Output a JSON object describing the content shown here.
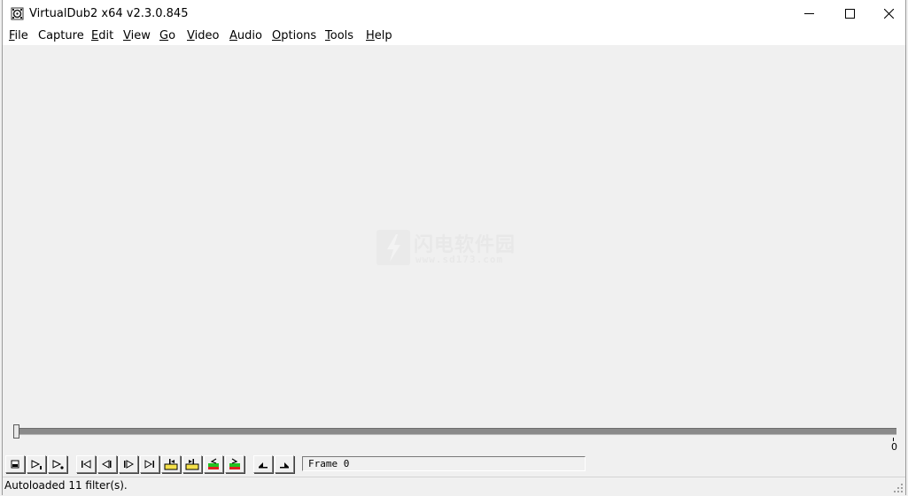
{
  "window": {
    "title": "VirtualDub2 x64 v2.3.0.845"
  },
  "menu": [
    {
      "mnemonic": "F",
      "rest": "ile"
    },
    {
      "mnemonic": "",
      "rest": "Capture"
    },
    {
      "mnemonic": "E",
      "rest": "dit"
    },
    {
      "mnemonic": "V",
      "rest": "iew"
    },
    {
      "mnemonic": "G",
      "rest": "o"
    },
    {
      "mnemonic": "V",
      "rest": "ideo"
    },
    {
      "mnemonic": "A",
      "rest": "udio"
    },
    {
      "mnemonic": "O",
      "rest": "ptions"
    },
    {
      "mnemonic": "T",
      "rest": "ools"
    },
    {
      "mnemonic": "H",
      "rest": "elp"
    }
  ],
  "watermark": {
    "cn": "闪电软件园",
    "url": "www.sd173.com"
  },
  "timeline": {
    "position_fraction": 0,
    "end_label": "0"
  },
  "toolbar": {
    "icons": [
      "stop-icon",
      "play-input-icon",
      "play-output-icon",
      "go-start-icon",
      "step-back-icon",
      "step-forward-icon",
      "go-end-icon",
      "prev-key-icon",
      "next-key-icon",
      "scene-back-icon",
      "scene-forward-icon",
      "mark-in-icon",
      "mark-out-icon"
    ],
    "frame_text": "Frame 0"
  },
  "status": {
    "text": "Autoloaded 11 filter(s)."
  },
  "colors": {
    "key_yellow": "#f4e04a",
    "scene_green": "#22c322",
    "scene_red": "#e02020"
  }
}
